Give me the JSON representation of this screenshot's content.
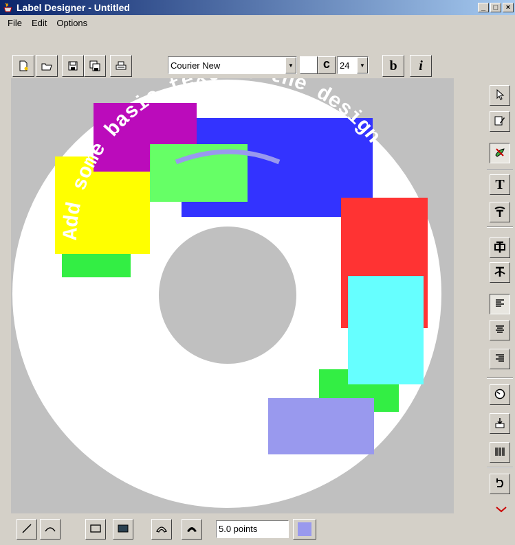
{
  "window": {
    "title": "Label Designer - Untitled",
    "controls": {
      "minimize": "_",
      "maximize": "□",
      "close": "×"
    }
  },
  "menu": [
    "File",
    "Edit",
    "Options"
  ],
  "toolbar": {
    "font_name": "Courier New",
    "font_style_label": "c",
    "font_size": "24",
    "bold_label": "b",
    "italic_label": "i"
  },
  "canvas": {
    "curved_text": "Add some basic text to the design",
    "colors": {
      "background": "#c0c0c0",
      "disc": "#ffffff",
      "hub": "#c0c0c0",
      "magenta": "#bb0bbb",
      "blue": "#3333ff",
      "green": "#66ff66",
      "yellow": "#ffff00",
      "bright_green": "#33ee44",
      "red": "#ff3333",
      "cyan": "#66ffff",
      "lavender": "#9999ee"
    }
  },
  "bottom": {
    "line_width": "5.0 points",
    "stroke_color": "#9999ee"
  }
}
